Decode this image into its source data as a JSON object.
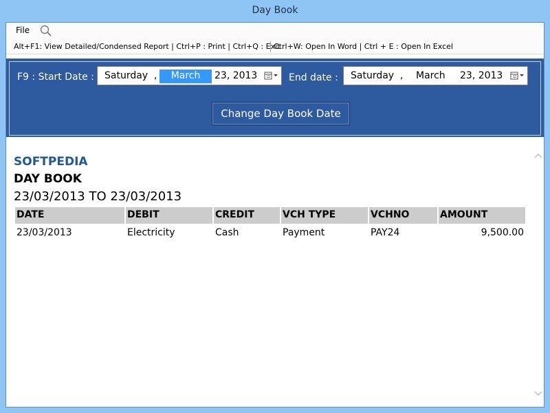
{
  "window": {
    "title": "Day Book"
  },
  "menubar": {
    "file_label": "File",
    "search_icon": "search-icon"
  },
  "shortcuts": {
    "left": "Alt+F1: View Detailed/Condensed Report | Ctrl+P : Print | Ctrl+Q : Exit",
    "right": "Ctrl+W: Open In Word | Ctrl + E : Open In Excel"
  },
  "date_panel": {
    "start_label": "F9 : Start Date :",
    "start": {
      "weekday": "Saturday",
      "comma": ",",
      "month": "March",
      "day_year": "23, 2013"
    },
    "end_label": "End date :",
    "end": {
      "weekday": "Saturday",
      "comma": ",",
      "month": "March",
      "day_year": "23, 2013"
    },
    "change_button": "Change Day Book Date"
  },
  "report": {
    "company": "SOFTPEDIA",
    "title": "DAY BOOK",
    "range": "23/03/2013 TO 23/03/2013",
    "columns": [
      "DATE",
      "DEBIT",
      "CREDIT",
      "VCH TYPE",
      "VCHNO",
      "AMOUNT"
    ],
    "rows": [
      [
        "23/03/2013",
        "Electricity",
        "Cash",
        "Payment",
        "PAY24",
        "9,500.00"
      ]
    ]
  },
  "colors": {
    "title_bar": "#8ec5f5",
    "panel": "#2e5aa0",
    "selection": "#3399ff",
    "company": "#1f5a94",
    "header_cell": "#cccccc"
  }
}
